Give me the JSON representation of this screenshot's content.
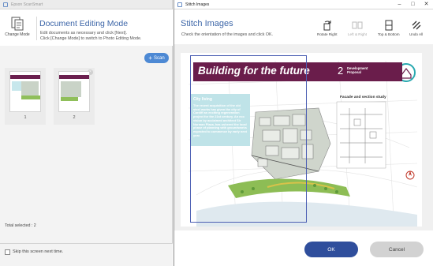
{
  "left_window": {
    "title": "Epson ScanSmart",
    "change_mode_label": "Change Mode",
    "mode_title": "Document Editing Mode",
    "mode_desc_line1": "Edit documents as necessary and click [Next].",
    "mode_desc_line2": "Click [Change Mode] to switch to Photo Editing Mode.",
    "scan_label": "Scan",
    "thumbnails": [
      {
        "number": "1"
      },
      {
        "number": "2"
      }
    ],
    "total_selected": "Total selected : 2",
    "skip_label": "Skip this screen next time."
  },
  "right_window": {
    "title": "Stitch Images",
    "controls": {
      "minimize": "–",
      "maximize": "□",
      "close": "✕"
    },
    "heading": "Stitch Images",
    "subheading": "Check the orientation of the images and click OK.",
    "tools": [
      {
        "label": "Rotate Right",
        "icon": "rotate-right-icon",
        "enabled": true
      },
      {
        "label": "Left & Right",
        "icon": "left-right-icon",
        "enabled": false
      },
      {
        "label": "Top & Bottom",
        "icon": "top-bottom-icon",
        "enabled": true
      },
      {
        "label": "Undo All",
        "icon": "undo-all-icon",
        "enabled": true
      }
    ],
    "preview": {
      "banner_title": "Building for the future",
      "banner_number": "2",
      "banner_subtitle_line1": "Development",
      "banner_subtitle_line2": "Proposal",
      "info_heading": "City living",
      "info_text": "The recent acquisition of the old steel works has given the city of Cardiff an exciting regeneration project for the 21st century. An eco vision by acclaimed architect Sir Norman Plaza, has ushered the local phase of planning with groundworks expected to commence by early next year.",
      "facade_heading": "Facade and section study"
    },
    "ok_label": "OK",
    "cancel_label": "Cancel",
    "colors": {
      "accent": "#3d66a8",
      "banner": "#6a1d4b",
      "ok_button": "#2f4e9c",
      "scan_button": "#4d89d4",
      "selection": "#4b5eb3"
    }
  }
}
